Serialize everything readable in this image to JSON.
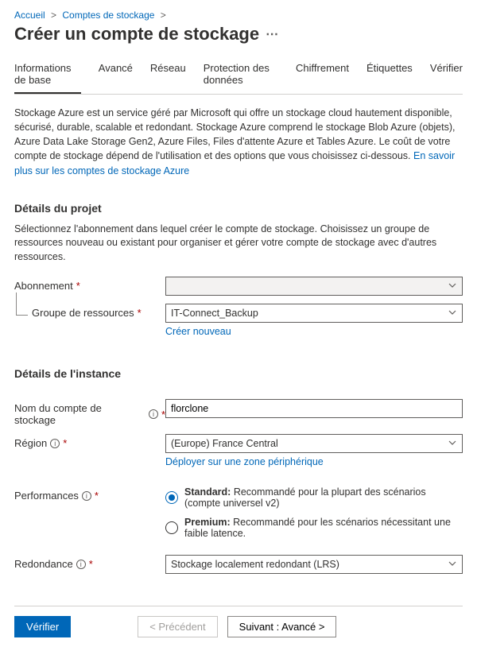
{
  "breadcrumbs": {
    "home": "Accueil",
    "accounts": "Comptes de stockage"
  },
  "page_title": "Créer un compte de stockage",
  "tabs": {
    "basics": "Informations de base",
    "advanced": "Avancé",
    "network": "Réseau",
    "data": "Protection des données",
    "encryption": "Chiffrement",
    "tags": "Étiquettes",
    "verify": "Vérifier"
  },
  "intro": {
    "text": "Stockage Azure est un service géré par Microsoft qui offre un stockage cloud hautement disponible, sécurisé, durable, scalable et redondant. Stockage Azure comprend le stockage Blob Azure (objets), Azure Data Lake Storage Gen2, Azure Files, Files d'attente Azure et Tables Azure. Le coût de votre compte de stockage dépend de l'utilisation et des options que vous choisissez ci-dessous. ",
    "link": "En savoir plus sur les comptes de stockage Azure"
  },
  "project": {
    "heading": "Détails du projet",
    "desc": "Sélectionnez l'abonnement dans lequel créer le compte de stockage. Choisissez un groupe de ressources nouveau ou existant pour organiser et gérer votre compte de stockage avec d'autres ressources.",
    "subscription_label": "Abonnement",
    "subscription_value": "",
    "rg_label": "Groupe de ressources",
    "rg_value": "IT-Connect_Backup",
    "create_new": "Créer nouveau"
  },
  "instance": {
    "heading": "Détails de l'instance",
    "name_label": "Nom du compte de stockage",
    "name_value": "florclone",
    "region_label": "Région",
    "region_value": "(Europe) France Central",
    "deploy_edge": "Déployer sur une zone périphérique",
    "perf_label": "Performances",
    "perf_standard_b": "Standard:",
    "perf_standard_t": " Recommandé pour la plupart des scénarios (compte universel v2)",
    "perf_premium_b": "Premium:",
    "perf_premium_t": " Recommandé pour les scénarios nécessitant une faible latence.",
    "redundancy_label": "Redondance",
    "redundancy_value": "Stockage localement redondant (LRS)"
  },
  "footer": {
    "verify": "Vérifier",
    "prev": "< Précédent",
    "next": "Suivant : Avancé >"
  }
}
